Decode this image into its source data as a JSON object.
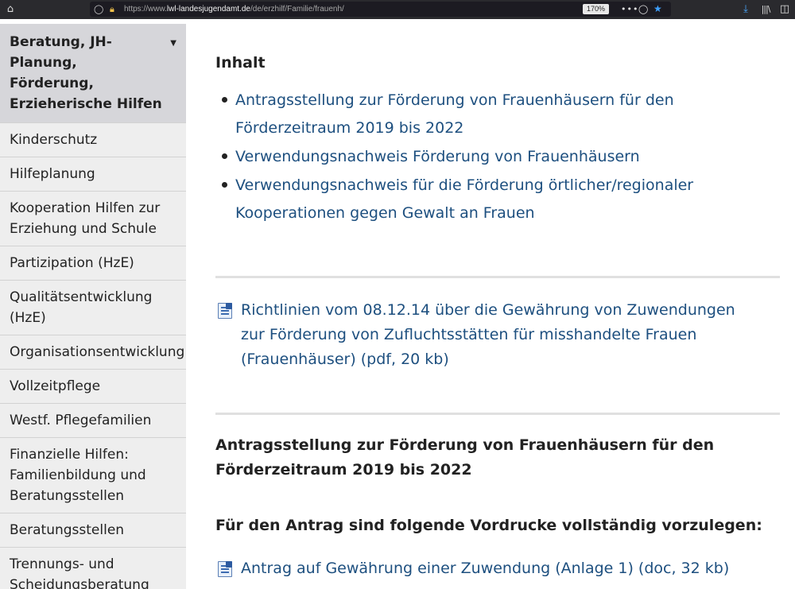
{
  "browser": {
    "url_prefix": "https://www.",
    "url_host": "lwl-landesjugendamt.de",
    "url_path": "/de/erzhilf/Familie/frauenh/",
    "zoom": "170%"
  },
  "sidebar": {
    "active_item": "Beratung, JH-Planung, Förderung, Erzieherische Hilfen",
    "items": [
      "Kinderschutz",
      "Hilfeplanung",
      "Kooperation Hilfen zur Erziehung und Schule",
      "Partizipation (HzE)",
      "Qualitätsentwicklung (HzE)",
      "Organisationsentwicklung",
      "Vollzeitpflege",
      "Westf. Pflegefamilien",
      "Finanzielle Hilfen: Familienbildung und Beratungsstellen",
      "Beratungsstellen",
      "Trennungs- und Scheidungsberatung"
    ]
  },
  "main": {
    "toc_title": "Inhalt",
    "toc_links": [
      "Antragsstellung zur Förderung von Frauenhäusern für den Förderzeitraum 2019 bis 2022",
      "Verwendungsnachweis Förderung von Frauenhäusern",
      "Verwendungsnachweis für die Förderung örtlicher/regionaler Kooperationen gegen Gewalt an Frauen"
    ],
    "doc_richtlinien": "Richtlinien vom 08.12.14 über die Gewährung von Zuwendungen zur Förderung von Zufluchtsstätten für misshandelte Frauen (Frauenhäuser) (pdf, 20 kb)",
    "section_title": "Antragsstellung zur Förderung von Frauenhäusern für den Förderzeitraum 2019 bis 2022",
    "section_subtitle": "Für den Antrag sind folgende Vordrucke vollständig vorzulegen:",
    "doc_antrag": "Antrag auf Gewährung einer Zuwendung (Anlage 1) (doc, 32 kb)"
  },
  "icons": {
    "home": "home-icon",
    "shield": "shield-icon",
    "lock": "lock-icon",
    "pocket": "pocket-icon",
    "bookmark": "star-icon",
    "download": "download-icon",
    "library": "library-icon",
    "sidebar": "sidebar-icon",
    "document": "word-document-icon"
  }
}
